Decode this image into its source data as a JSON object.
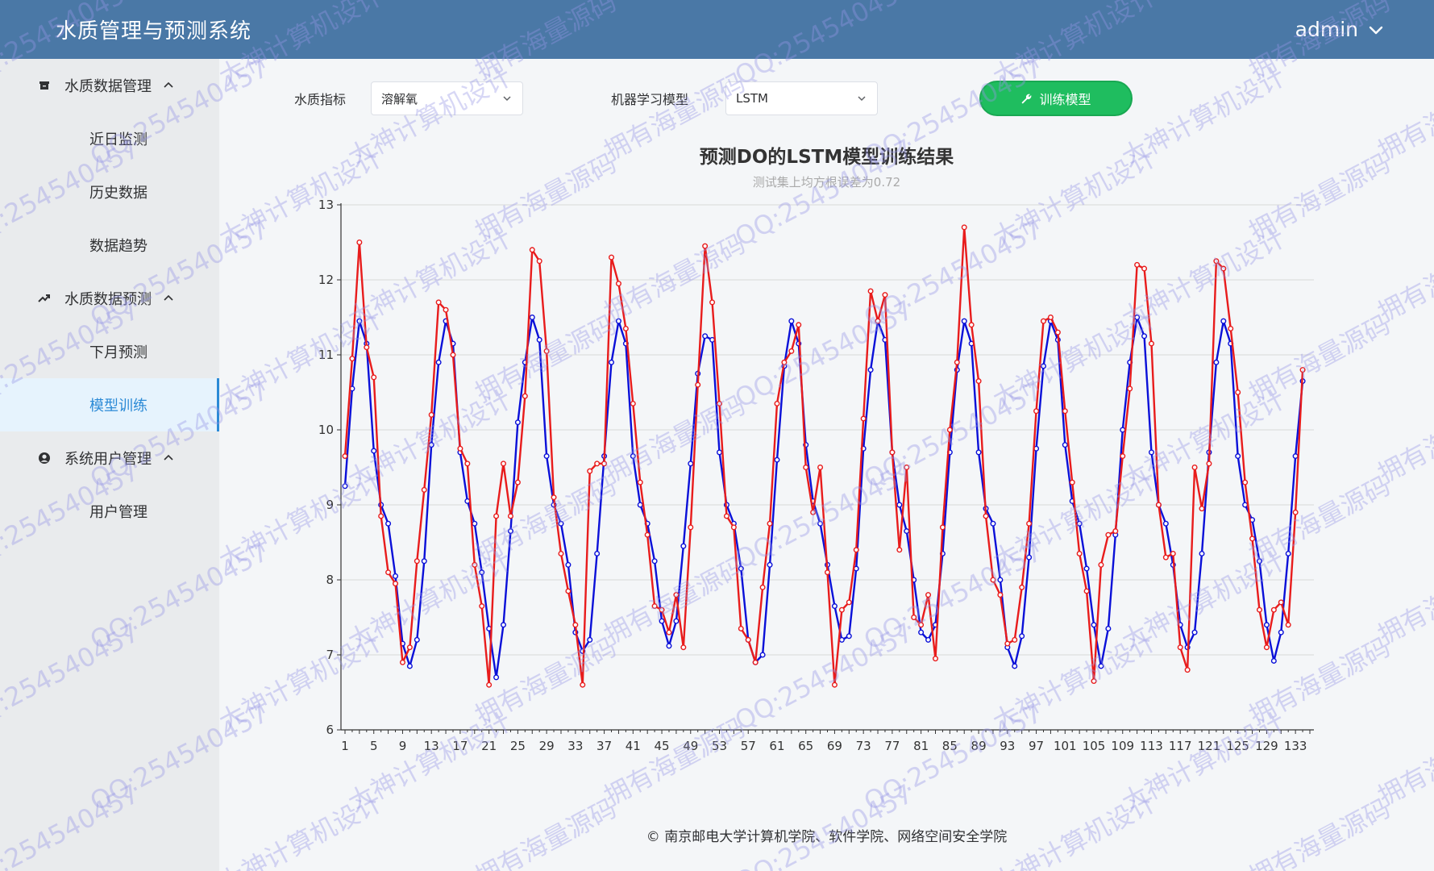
{
  "header": {
    "title": "水质管理与预测系统",
    "user": "admin"
  },
  "sidebar": {
    "groups": [
      {
        "label": "水质数据管理",
        "icon": "archive-icon",
        "items": [
          "近日监测",
          "历史数据",
          "数据趋势"
        ]
      },
      {
        "label": "水质数据预测",
        "icon": "trend-icon",
        "items": [
          "下月预测",
          "模型训练"
        ]
      },
      {
        "label": "系统用户管理",
        "icon": "user-circle-icon",
        "items": [
          "用户管理"
        ]
      }
    ],
    "active_item": "模型训练"
  },
  "filters": {
    "indicator_label": "水质指标",
    "indicator_value": "溶解氧",
    "model_label": "机器学习模型",
    "model_value": "LSTM",
    "train_button": "训练模型"
  },
  "chart_data": {
    "type": "line",
    "title": "预测DO的LSTM模型训练结果",
    "subtitle": "测试集上均方根误差为0.72",
    "ylim": [
      6,
      13
    ],
    "yticks": [
      6,
      7,
      8,
      9,
      10,
      11,
      12,
      13
    ],
    "x_start": 1,
    "x_end": 135,
    "xticks": [
      1,
      5,
      9,
      13,
      17,
      21,
      25,
      29,
      33,
      37,
      41,
      45,
      49,
      53,
      57,
      61,
      65,
      69,
      73,
      77,
      81,
      85,
      89,
      93,
      97,
      101,
      105,
      109,
      113,
      117,
      121,
      125,
      129,
      133
    ],
    "grid": "horizontal",
    "series": [
      {
        "color": "#0a10d8",
        "values": [
          9.25,
          10.55,
          11.45,
          11.15,
          9.72,
          9.0,
          8.75,
          8.05,
          7.15,
          6.85,
          7.2,
          8.25,
          9.8,
          10.9,
          11.45,
          11.15,
          9.7,
          9.05,
          8.75,
          8.1,
          7.35,
          6.7,
          7.4,
          8.65,
          10.1,
          10.9,
          11.5,
          11.2,
          9.65,
          9.0,
          8.75,
          8.2,
          7.3,
          7.05,
          7.2,
          8.35,
          9.65,
          10.9,
          11.45,
          11.15,
          9.65,
          9.0,
          8.75,
          8.25,
          7.45,
          7.12,
          7.45,
          8.45,
          9.55,
          10.75,
          11.25,
          11.2,
          9.7,
          9.0,
          8.75,
          8.15,
          7.2,
          6.9,
          7.0,
          8.2,
          9.6,
          10.85,
          11.45,
          11.15,
          9.8,
          9.05,
          8.75,
          8.2,
          7.65,
          7.2,
          7.25,
          8.15,
          9.75,
          10.8,
          11.45,
          11.2,
          9.7,
          9.0,
          8.65,
          8.0,
          7.3,
          7.2,
          7.4,
          8.35,
          9.7,
          10.8,
          11.45,
          11.15,
          9.7,
          8.95,
          8.75,
          8.0,
          7.1,
          6.85,
          7.25,
          8.3,
          9.75,
          10.85,
          11.45,
          11.2,
          9.8,
          9.05,
          8.75,
          8.15,
          7.4,
          6.85,
          7.35,
          8.6,
          10.0,
          10.9,
          11.5,
          11.25,
          9.7,
          9.0,
          8.75,
          8.2,
          7.4,
          7.1,
          7.3,
          8.35,
          9.7,
          10.9,
          11.45,
          11.15,
          9.65,
          9.0,
          8.8,
          8.25,
          7.4,
          6.92,
          7.3,
          8.35,
          9.65,
          10.65
        ]
      },
      {
        "color": "#e81c1c",
        "values": [
          9.65,
          10.95,
          12.5,
          11.1,
          10.7,
          8.85,
          8.1,
          7.95,
          6.9,
          7.1,
          8.25,
          9.2,
          10.2,
          11.7,
          11.6,
          11.0,
          9.75,
          9.55,
          8.2,
          7.65,
          6.6,
          8.85,
          9.55,
          8.85,
          9.3,
          10.45,
          12.4,
          12.25,
          11.05,
          9.1,
          8.35,
          7.85,
          7.4,
          6.6,
          9.45,
          9.55,
          9.55,
          12.3,
          11.95,
          11.35,
          10.35,
          9.3,
          8.6,
          7.65,
          7.6,
          7.3,
          7.8,
          7.1,
          8.7,
          10.6,
          12.45,
          11.7,
          10.35,
          8.85,
          8.7,
          7.35,
          7.2,
          6.9,
          7.9,
          8.75,
          10.35,
          10.9,
          11.05,
          11.4,
          9.5,
          8.9,
          9.5,
          8.1,
          6.6,
          7.6,
          7.7,
          8.4,
          10.15,
          11.85,
          11.45,
          11.8,
          9.7,
          8.4,
          9.5,
          7.5,
          7.4,
          7.8,
          6.95,
          8.7,
          10.0,
          10.9,
          12.7,
          11.4,
          10.65,
          8.85,
          8.0,
          7.8,
          7.15,
          7.2,
          7.9,
          8.75,
          10.25,
          11.45,
          11.5,
          11.3,
          10.25,
          9.3,
          8.35,
          7.85,
          6.65,
          8.2,
          8.6,
          8.65,
          9.65,
          10.55,
          12.2,
          12.15,
          11.15,
          9.0,
          8.3,
          8.35,
          7.1,
          6.8,
          9.5,
          8.95,
          9.55,
          12.25,
          12.15,
          11.35,
          10.5,
          9.3,
          8.55,
          7.6,
          7.1,
          7.6,
          7.7,
          7.4,
          8.9,
          10.8
        ]
      }
    ]
  },
  "footer": "© 南京邮电大学计算机学院、软件学院、网络空间安全学院",
  "watermark": {
    "texts": [
      "QQ:254540457",
      "大神计算机设计",
      "拥有海量源码"
    ]
  }
}
